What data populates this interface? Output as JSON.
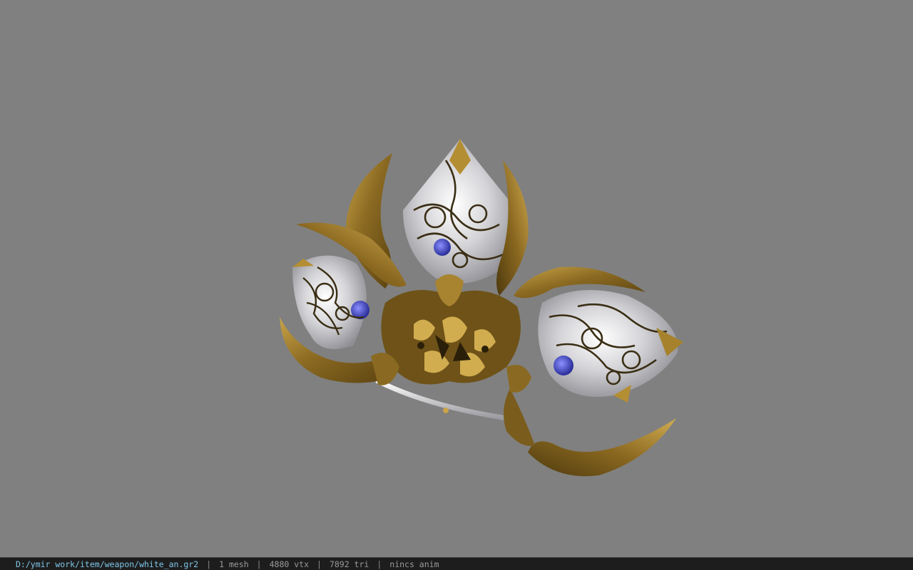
{
  "viewport": {
    "background": "#808080",
    "subject": "white-an-weapon-model"
  },
  "status": {
    "file_path": "D:/ymir work/item/weapon/white_an.gr2",
    "separator": "|",
    "mesh_count": "1 mesh",
    "vertex_count": "4880 vtx",
    "triangle_count": "7892 tri",
    "animation": "nincs anim"
  },
  "colors": {
    "path_text": "#7fc6e8",
    "stat_text": "#9a9a9a",
    "status_bg": "#1d1d1d",
    "gold": "#9a7a2c",
    "silver": "#d8d8dc",
    "gem": "#3a3fb8"
  }
}
